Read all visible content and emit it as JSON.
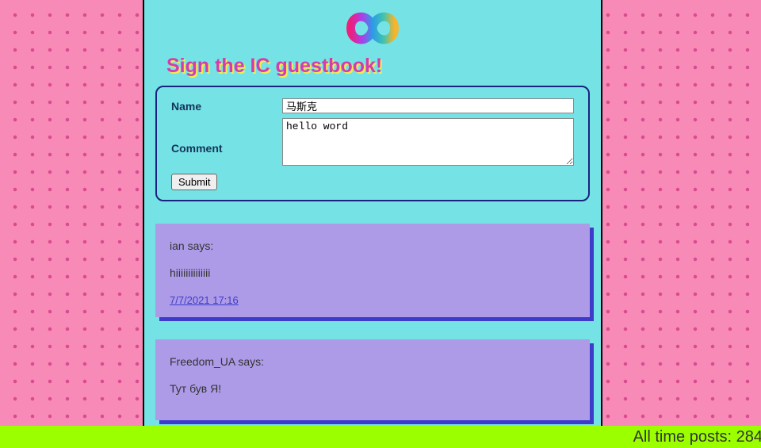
{
  "heading": "Sign the IC guestbook!",
  "form": {
    "name_label": "Name",
    "name_value": "马斯克",
    "comment_label": "Comment",
    "comment_value": "hello word",
    "submit_label": "Submit"
  },
  "posts": [
    {
      "author_line": "ian says:",
      "body": "hiiiiiiiiiiiiii",
      "timestamp": "7/7/2021 17:16"
    },
    {
      "author_line": "Freedom_UA says:",
      "body": "Тут був Я!",
      "timestamp": ""
    }
  ],
  "footer": {
    "label": "All time posts: 284"
  }
}
